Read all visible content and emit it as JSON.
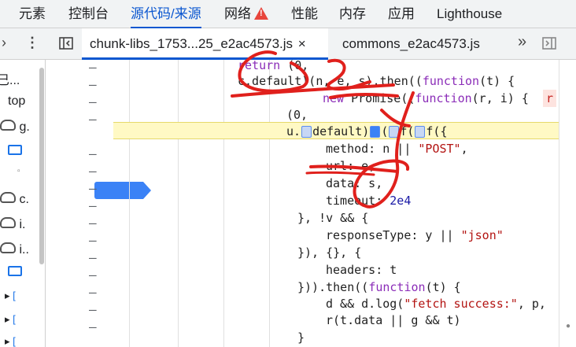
{
  "top_tabs": [
    "元素",
    "控制台",
    "源代码/来源",
    "网络",
    "性能",
    "内存",
    "应用",
    "Lighthouse"
  ],
  "file_tabs": [
    {
      "label": "chunk-libs_1753...25_e2ac4573.js",
      "close": "×"
    },
    {
      "label": "commons_e2ac4573.js"
    }
  ],
  "sidebar": {
    "items": [
      "巳...",
      "top",
      "g.",
      "c.",
      "i.",
      "i.."
    ]
  },
  "gutter_mark": "–",
  "code_lines": {
    "l1": "return (0,",
    "l2": "c.default)(n, e, s).then((",
    "l2b": "function",
    "l2c": "(t) {",
    "l3": "new Promise((",
    "l3b": "function",
    "l3c": "(r, i) {",
    "l3d": "r",
    "l4": "(0,",
    "l5a": "u.",
    "l5b": "default)",
    "l5c": "(",
    "l5d": "f(",
    "l5e": "f({",
    "l6a": "method: n || ",
    "l6b": "\"POST\"",
    "l6c": ",",
    "l7": "url: e,",
    "l8": "data: s,",
    "l9a": "timeout: ",
    "l9b": "2e4",
    "l10": "}, !v && {",
    "l11a": "responseType: y || ",
    "l11b": "\"json\"",
    "l12": "}), {}, {",
    "l13": "headers: t",
    "l14a": "})).then((",
    "l14b": "function",
    "l14c": "(t) {",
    "l15a": "d && d.log(",
    "l15b": "\"fetch success:\"",
    "l15c": ", p,",
    "l16": "r(t.data || g && t)",
    "l17": "}"
  },
  "colors": {
    "accent": "#0b57d0",
    "breakpoint": "#3b82f6",
    "highlight": "#fff9c4",
    "annotation_ink": "#e0201c"
  }
}
